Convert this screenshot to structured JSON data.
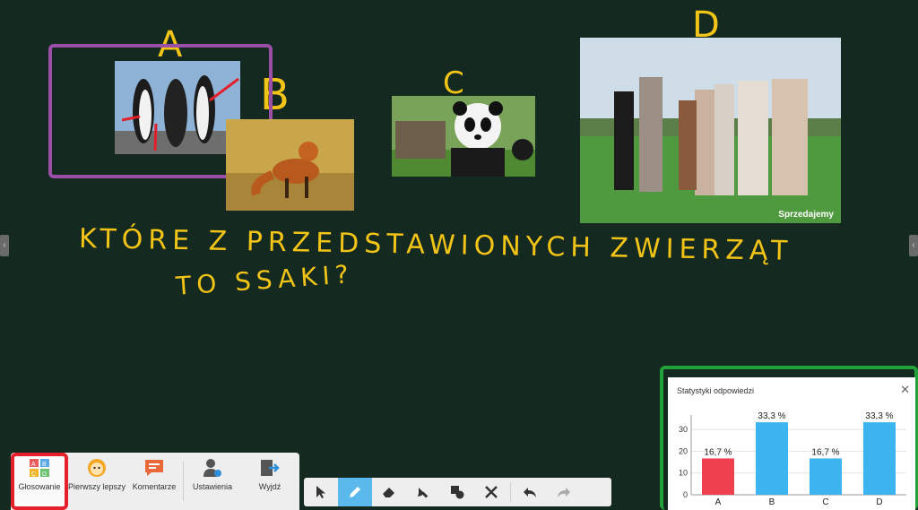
{
  "board": {
    "labels": {
      "a": "A",
      "b": "B",
      "c": "C",
      "d": "D"
    },
    "question_line1": "KTÓRE Z PRZEDSTAWIONYCH ZWIERZĄT",
    "question_line2": "TO SSAKI?",
    "watermark": "Sprzedajemy"
  },
  "menu": {
    "items": [
      {
        "label": "Głosowanie",
        "icon": "abcd-vote-icon",
        "active": true
      },
      {
        "label": "Pierwszy lepszy",
        "icon": "smiley-face-icon"
      },
      {
        "label": "Komentarze",
        "icon": "comment-icon"
      },
      {
        "label": "Ustawienia",
        "icon": "user-settings-icon"
      },
      {
        "label": "Wyjdź",
        "icon": "exit-icon"
      }
    ]
  },
  "tools": [
    {
      "icon": "cursor-icon"
    },
    {
      "icon": "pen-icon",
      "active": true
    },
    {
      "icon": "eraser-icon"
    },
    {
      "icon": "highlighter-icon"
    },
    {
      "icon": "shapes-icon"
    },
    {
      "icon": "tools-icon"
    },
    {
      "icon": "undo-icon"
    },
    {
      "icon": "redo-icon"
    }
  ],
  "stats": {
    "title": "Statystyki odpowiedzi",
    "close": "✕",
    "chart_data": {
      "type": "bar",
      "categories": [
        "A",
        "B",
        "C",
        "D"
      ],
      "values": [
        16.7,
        33.3,
        16.7,
        33.3
      ],
      "data_labels": [
        "16,7 %",
        "33,3 %",
        "16,7 %",
        "33,3 %"
      ],
      "colors": [
        "#ef4050",
        "#3bb4ef",
        "#3bb4ef",
        "#3bb4ef"
      ],
      "yticks": [
        "0",
        "10",
        "20",
        "30"
      ],
      "ylim": [
        0,
        35
      ],
      "grid": true
    }
  },
  "colors": {
    "board": "#14291f",
    "chalk_yellow": "#f2c417",
    "frame_purple": "#9c4fa6",
    "frame_green": "#22a33a",
    "active_red": "#e6202a"
  }
}
